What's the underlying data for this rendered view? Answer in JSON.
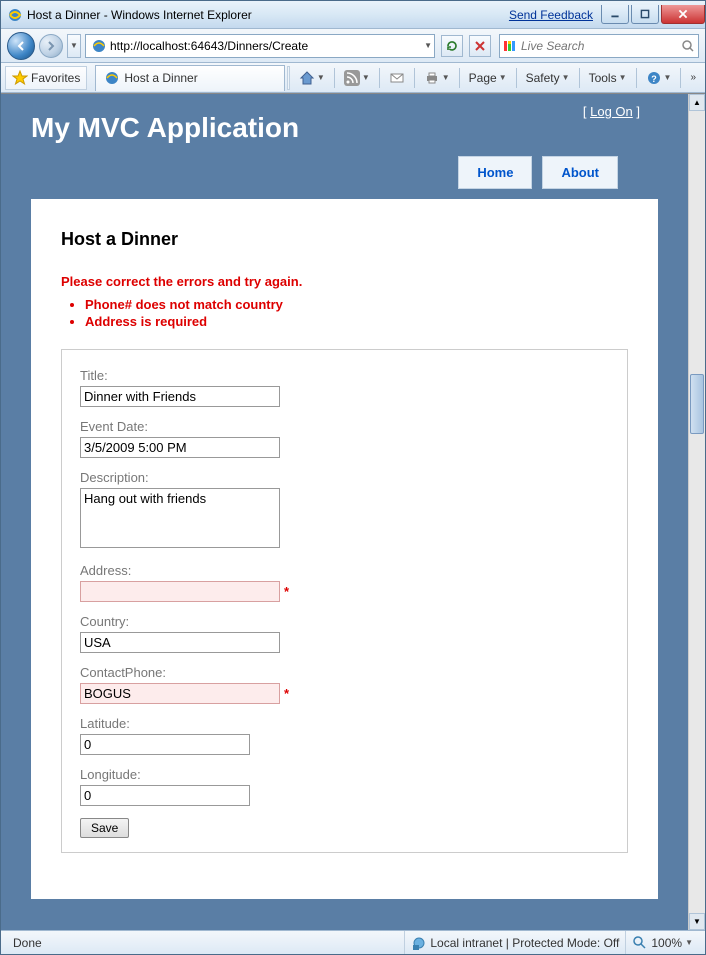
{
  "window": {
    "title": "Host a Dinner - Windows Internet Explorer",
    "feedback": "Send Feedback"
  },
  "nav": {
    "url": "http://localhost:64643/Dinners/Create",
    "search_placeholder": "Live Search"
  },
  "cmdbar": {
    "favorites": "Favorites",
    "tab_title": "Host a Dinner",
    "page": "Page",
    "safety": "Safety",
    "tools": "Tools"
  },
  "mvc": {
    "app_title": "My MVC Application",
    "logon_label": "Log On",
    "nav_home": "Home",
    "nav_about": "About",
    "page_heading": "Host a Dinner",
    "validation_summary": "Please correct the errors and try again.",
    "errors": [
      "Phone# does not match country",
      "Address is required"
    ],
    "fields": {
      "title_label": "Title:",
      "title_value": "Dinner with Friends",
      "eventdate_label": "Event Date:",
      "eventdate_value": "3/5/2009 5:00 PM",
      "description_label": "Description:",
      "description_value": "Hang out with friends",
      "address_label": "Address:",
      "address_value": "",
      "country_label": "Country:",
      "country_value": "USA",
      "phone_label": "ContactPhone:",
      "phone_value": "BOGUS",
      "lat_label": "Latitude:",
      "lat_value": "0",
      "lon_label": "Longitude:",
      "lon_value": "0"
    },
    "save_label": "Save"
  },
  "status": {
    "done": "Done",
    "zone": "Local intranet | Protected Mode: Off",
    "zoom": "100%"
  }
}
